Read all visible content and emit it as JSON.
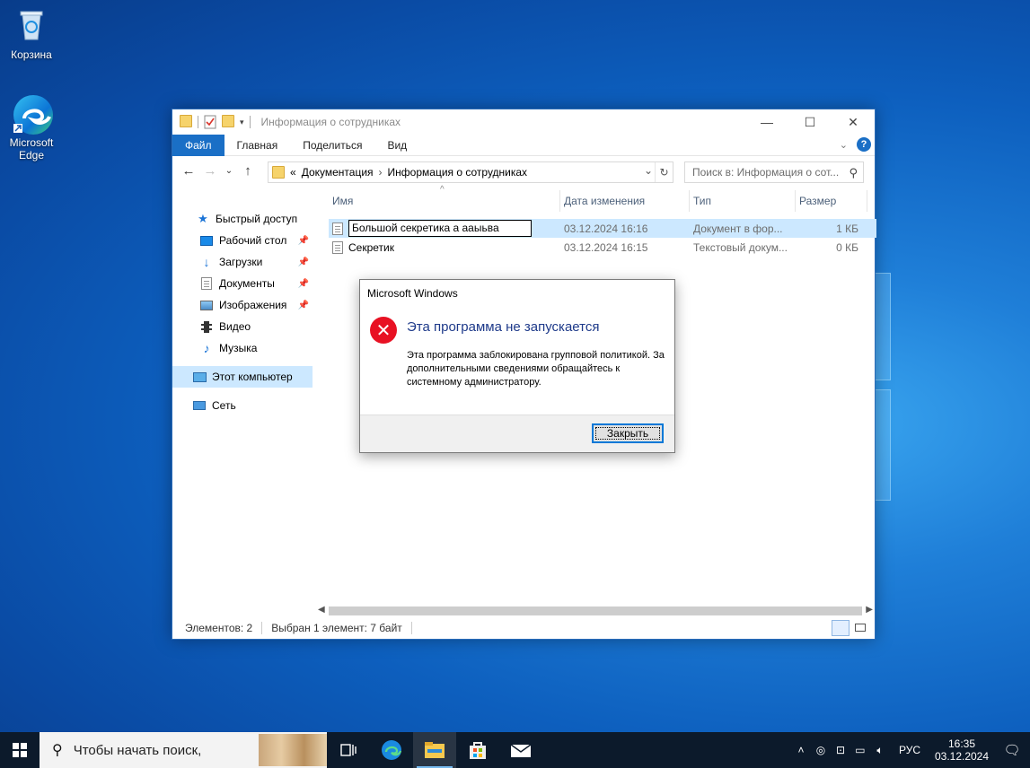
{
  "desktop": {
    "icons": [
      {
        "label": "Корзина"
      },
      {
        "label": "Microsoft Edge"
      }
    ]
  },
  "explorer": {
    "title": "Информация о сотрудниках",
    "controls": {
      "minimize": "—",
      "maximize": "☐",
      "close": "✕"
    },
    "ribbon": {
      "tabs": [
        "Файл",
        "Главная",
        "Поделиться",
        "Вид"
      ]
    },
    "address": {
      "prefix": "«",
      "segments": [
        "Документация",
        "Информация о сотрудниках"
      ]
    },
    "search_placeholder": "Поиск в: Информация о сот...",
    "sidebar": [
      {
        "label": "Быстрый доступ",
        "icon": "star-icon",
        "pinned": false
      },
      {
        "label": "Рабочий стол",
        "icon": "desktop-icon",
        "pinned": true
      },
      {
        "label": "Загрузки",
        "icon": "download-icon",
        "pinned": true
      },
      {
        "label": "Документы",
        "icon": "document-icon",
        "pinned": true
      },
      {
        "label": "Изображения",
        "icon": "image-icon",
        "pinned": true
      },
      {
        "label": "Видео",
        "icon": "video-icon",
        "pinned": false
      },
      {
        "label": "Музыка",
        "icon": "music-icon",
        "pinned": false
      },
      {
        "label": "Этот компьютер",
        "icon": "computer-icon",
        "pinned": false,
        "selected": true
      },
      {
        "label": "Сеть",
        "icon": "network-icon",
        "pinned": false
      }
    ],
    "columns": [
      "Имя",
      "Дата изменения",
      "Тип",
      "Размер"
    ],
    "files": [
      {
        "name": "Большой секретика а ааыьва",
        "date": "03.12.2024 16:16",
        "type": "Документ в фор...",
        "size": "1 КБ",
        "selected": true,
        "renaming": true
      },
      {
        "name": "Секретик",
        "date": "03.12.2024 16:15",
        "type": "Текстовый докум...",
        "size": "0 КБ",
        "selected": false
      }
    ],
    "status": {
      "count": "Элементов: 2",
      "selection": "Выбран 1 элемент: 7 байт"
    }
  },
  "dialog": {
    "title": "Microsoft Windows",
    "heading": "Эта программа не запускается",
    "message": "Эта программа заблокирована групповой политикой. За дополнительными сведениями обращайтесь к системному администратору.",
    "button": "Закрыть",
    "accent": "#e81123"
  },
  "taskbar": {
    "search_placeholder": "Чтобы начать поиск,",
    "apps": [
      "task-view-icon",
      "edge-icon",
      "file-explorer-icon",
      "store-icon",
      "mail-icon"
    ],
    "tray": {
      "language": "РУС",
      "time": "16:35",
      "date": "03.12.2024"
    }
  }
}
